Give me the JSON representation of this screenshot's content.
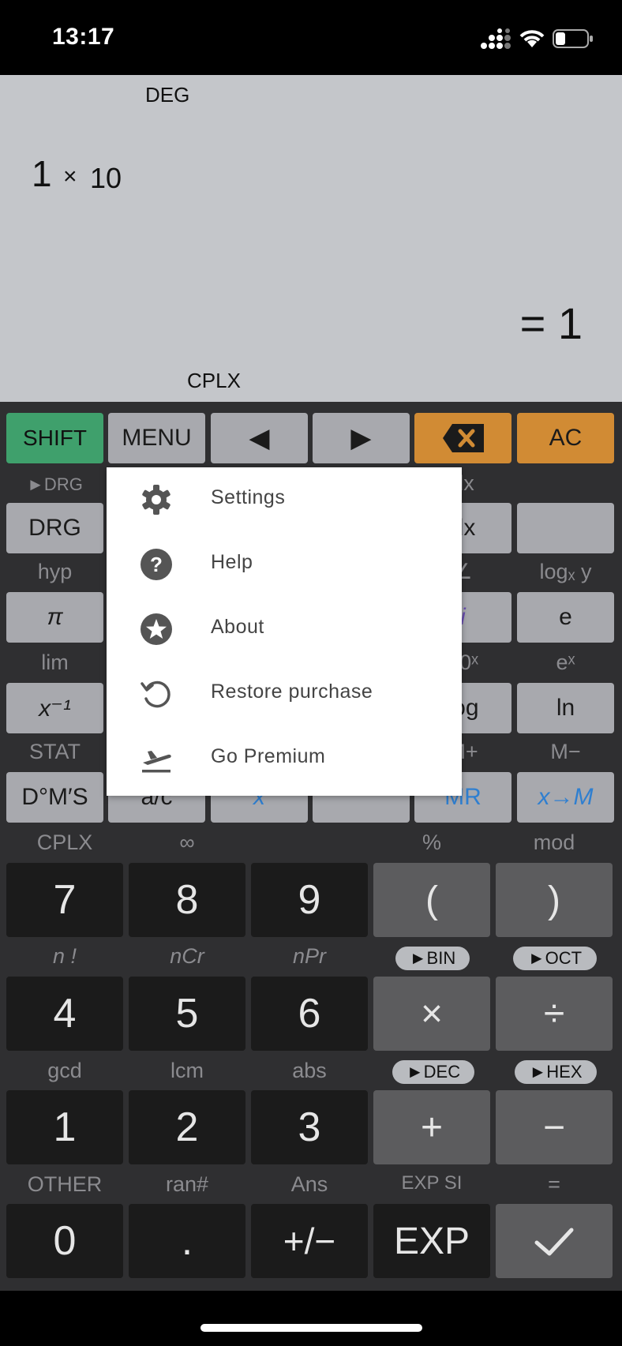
{
  "status": {
    "time": "13:17"
  },
  "display": {
    "mode_top": "DEG",
    "expression_parts": [
      "1",
      "×",
      "10"
    ],
    "result": "= 1",
    "mode_bottom": "CPLX"
  },
  "top_row": {
    "shift": "SHIFT",
    "menu": "MENU",
    "left": "◀",
    "right": "▶",
    "ac": "AC"
  },
  "sci": {
    "row1_labels": [
      "►DRG",
      "",
      "",
      "",
      "dx",
      ""
    ],
    "row1_keys": [
      "DRG",
      "",
      "",
      "",
      "dx",
      ""
    ],
    "row2_labels": [
      "hyp",
      "",
      "",
      "",
      "∠",
      "logₓ y"
    ],
    "row2_keys": [
      "π",
      "",
      "",
      "",
      "i",
      "e"
    ],
    "row3_labels": [
      "lim",
      "",
      "",
      "",
      "10ˣ",
      "eˣ"
    ],
    "row3_keys": [
      "x⁻¹",
      "",
      "",
      "",
      "log",
      "ln"
    ],
    "row4_labels": [
      "STAT",
      "",
      "",
      "",
      "M+",
      "M−"
    ],
    "row4_keys": [
      "D°M′S",
      "a/c",
      "x",
      "",
      "MR",
      "x→M"
    ]
  },
  "num": {
    "row1_labels": [
      "CPLX",
      "∞",
      "",
      "%",
      "mod"
    ],
    "row1_keys": [
      "7",
      "8",
      "9",
      "(",
      ")"
    ],
    "row2_labels": [
      "n !",
      "nCr",
      "nPr",
      "►BIN",
      "►OCT"
    ],
    "row2_keys": [
      "4",
      "5",
      "6",
      "×",
      "÷"
    ],
    "row3_labels": [
      "gcd",
      "lcm",
      "abs",
      "►DEC",
      "►HEX"
    ],
    "row3_keys": [
      "1",
      "2",
      "3",
      "+",
      "−"
    ],
    "row4_labels": [
      "OTHER",
      "ran#",
      "Ans",
      "EXP SI",
      "="
    ],
    "row4_keys": [
      "0",
      ".",
      "+/−",
      "EXP",
      "✓"
    ]
  },
  "menu": {
    "items": [
      {
        "label": "Settings",
        "icon": "gear-icon"
      },
      {
        "label": "Help",
        "icon": "help-icon"
      },
      {
        "label": "About",
        "icon": "star-icon"
      },
      {
        "label": "Restore purchase",
        "icon": "restore-icon"
      },
      {
        "label": "Go Premium",
        "icon": "plane-takeoff-icon"
      }
    ]
  },
  "colors": {
    "shift": "#3fa06c",
    "orange": "#d18b34",
    "memory_blue": "#2f7fd0"
  }
}
